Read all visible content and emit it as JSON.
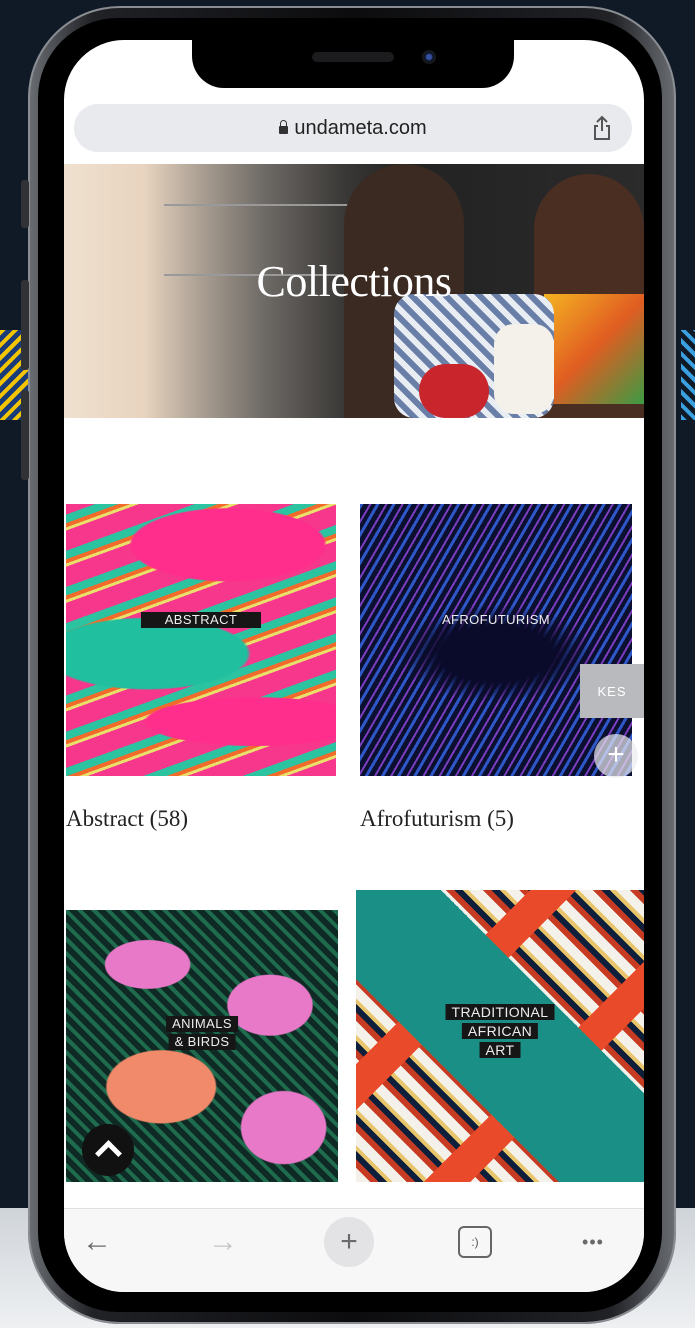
{
  "browser": {
    "url": "undameta.com",
    "nav": {
      "back": "←",
      "forward": "→",
      "new_tab": "+",
      "tabs": ":)",
      "more": "•••"
    }
  },
  "hero": {
    "title": "Collections"
  },
  "collections": [
    {
      "tile_label": "ABSTRACT",
      "caption": "Abstract (58)"
    },
    {
      "tile_label": "AFROFUTURISM",
      "caption": "Afrofuturism (5)"
    },
    {
      "tile_label_lines": [
        "ANIMALS",
        "& BIRDS"
      ]
    },
    {
      "tile_label_lines": [
        "TRADITIONAL",
        "AFRICAN",
        "ART"
      ]
    }
  ],
  "side_tab": {
    "label": "KES"
  },
  "colors": {
    "background": "#0f1a26",
    "page": "#ffffff",
    "url_bar": "#e8eaed",
    "label_bg": "#161616"
  },
  "icons": [
    "lock-icon",
    "share-icon",
    "plus-icon",
    "chevron-up-icon",
    "back-arrow-icon",
    "forward-arrow-icon",
    "tabs-icon",
    "more-icon"
  ]
}
